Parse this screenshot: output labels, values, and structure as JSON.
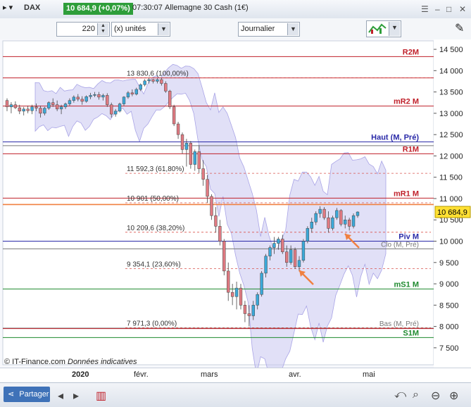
{
  "titlebar": {
    "instrument": "DAX",
    "quote": "10 684,9 (+0,07%)",
    "time": "07:30:07",
    "name": "Allemagne 30 Cash (1€)"
  },
  "toolbar": {
    "units_value": "220",
    "units_label": "(x) unités",
    "timeframe": "Journalier"
  },
  "colors": {
    "quote_bg": "#2e9e3a",
    "resistance": "#c0202a",
    "support": "#1e8a2e",
    "pivot": "#2a2aa8",
    "fibo": "#d9534f",
    "candle_up": "#3ba8d8",
    "candle_down": "#e07a82",
    "band": "#c9c6f0",
    "arrow": "#f08040"
  },
  "price_axis": {
    "min": 7300,
    "max": 14600,
    "ticks": [
      "14 500",
      "14 000",
      "13 500",
      "13 000",
      "12 500",
      "12 000",
      "11 500",
      "11 000",
      "10 500",
      "10 000",
      "9 500",
      "9 000",
      "8 500",
      "8 000",
      "7 500"
    ],
    "current": "10 684,9"
  },
  "time_axis": {
    "labels": [
      "2020",
      "févr.",
      "mars",
      "avr.",
      "mai"
    ]
  },
  "levels": [
    {
      "name": "R2M",
      "value": 14330,
      "type": "r"
    },
    {
      "name": "",
      "value": 13830,
      "type": "r"
    },
    {
      "name": "mR2 M",
      "value": 13170,
      "type": "r"
    },
    {
      "name": "Haut (M, Pré)",
      "value": 12330,
      "type": "p"
    },
    {
      "name": "",
      "value": 12240,
      "type": "g"
    },
    {
      "name": "R1M",
      "value": 12050,
      "type": "r"
    },
    {
      "name": "mR1 M",
      "value": 11010,
      "type": "r"
    },
    {
      "name": "",
      "value": 10860,
      "type": "o"
    },
    {
      "name": "Piv M",
      "value": 10000,
      "type": "p"
    },
    {
      "name": "Clo (M, Pré)",
      "value": 9820,
      "type": "g"
    },
    {
      "name": "mS1 M",
      "value": 8880,
      "type": "s"
    },
    {
      "name": "Bas (M, Pré)",
      "value": 7960,
      "type": "g"
    },
    {
      "name": "",
      "value": 7950,
      "type": "r"
    },
    {
      "name": "S1M",
      "value": 7740,
      "type": "s"
    }
  ],
  "fibo": [
    {
      "label": "13 830,6 (100,00%)",
      "value": 13830.6
    },
    {
      "label": "11 592,3 (61,80%)",
      "value": 11592.3
    },
    {
      "label": "10 901 (50,00%)",
      "value": 10901
    },
    {
      "label": "10 209,6 (38,20%)",
      "value": 10209.6
    },
    {
      "label": "9 354,1 (23,60%)",
      "value": 9354.1
    },
    {
      "label": "7 971,3 (0,00%)",
      "value": 7971.3
    }
  ],
  "footer": {
    "source": "© IT-Finance.com",
    "note": "Données indicatives"
  },
  "bottombar": {
    "share_label": "Partager"
  },
  "chart_data": {
    "type": "candlestick",
    "ohlc": [
      [
        13300,
        13350,
        13050,
        13150
      ],
      [
        13150,
        13260,
        13000,
        13200
      ],
      [
        13200,
        13280,
        13100,
        13130
      ],
      [
        13130,
        13200,
        12980,
        13050
      ],
      [
        13050,
        13150,
        12950,
        13100
      ],
      [
        13100,
        13180,
        13000,
        13060
      ],
      [
        13060,
        13200,
        12980,
        13150
      ],
      [
        13150,
        13230,
        13050,
        13120
      ],
      [
        13120,
        13180,
        12900,
        13000
      ],
      [
        13000,
        13150,
        12950,
        13120
      ],
      [
        13120,
        13280,
        13080,
        13250
      ],
      [
        13250,
        13350,
        13150,
        13200
      ],
      [
        13200,
        13300,
        13050,
        13100
      ],
      [
        13100,
        13200,
        12980,
        13150
      ],
      [
        13150,
        13250,
        13100,
        13220
      ],
      [
        13220,
        13350,
        13180,
        13300
      ],
      [
        13300,
        13420,
        13250,
        13380
      ],
      [
        13380,
        13450,
        13280,
        13330
      ],
      [
        13330,
        13400,
        13200,
        13280
      ],
      [
        13280,
        13420,
        13250,
        13390
      ],
      [
        13390,
        13480,
        13330,
        13420
      ],
      [
        13420,
        13500,
        13380,
        13440
      ],
      [
        13440,
        13500,
        13320,
        13380
      ],
      [
        13380,
        13460,
        13300,
        13420
      ],
      [
        13420,
        13470,
        13150,
        13200
      ],
      [
        13200,
        13250,
        12900,
        12980
      ],
      [
        12980,
        13100,
        12920,
        13050
      ],
      [
        13050,
        13250,
        13020,
        13220
      ],
      [
        13220,
        13400,
        13180,
        13380
      ],
      [
        13380,
        13520,
        13340,
        13480
      ],
      [
        13480,
        13560,
        13400,
        13450
      ],
      [
        13450,
        13600,
        13420,
        13560
      ],
      [
        13560,
        13700,
        13520,
        13670
      ],
      [
        13670,
        13800,
        13630,
        13760
      ],
      [
        13760,
        13830,
        13700,
        13790
      ],
      [
        13790,
        13810,
        13700,
        13750
      ],
      [
        13750,
        13820,
        13700,
        13790
      ],
      [
        13790,
        13830,
        13650,
        13700
      ],
      [
        13700,
        13750,
        13480,
        13520
      ],
      [
        13520,
        13550,
        13100,
        13150
      ],
      [
        13150,
        13200,
        12700,
        12750
      ],
      [
        12750,
        12800,
        12400,
        12500
      ],
      [
        12500,
        12550,
        12050,
        12150
      ],
      [
        12150,
        12400,
        11750,
        12300
      ],
      [
        12300,
        12350,
        11700,
        11800
      ],
      [
        11800,
        12150,
        11650,
        12100
      ],
      [
        12100,
        12250,
        11600,
        11700
      ],
      [
        11700,
        11900,
        11300,
        11450
      ],
      [
        11450,
        11550,
        10900,
        11050
      ],
      [
        11050,
        11100,
        10500,
        10600
      ],
      [
        10600,
        10800,
        10200,
        10350
      ],
      [
        10350,
        10500,
        9900,
        10000
      ],
      [
        10000,
        10050,
        9200,
        9300
      ],
      [
        9300,
        9500,
        8600,
        8800
      ],
      [
        8800,
        9000,
        8500,
        8700
      ],
      [
        8700,
        9050,
        8400,
        8900
      ],
      [
        8900,
        9000,
        8400,
        8500
      ],
      [
        8500,
        8600,
        8100,
        8300
      ],
      [
        8300,
        8500,
        8000,
        8250
      ],
      [
        8250,
        8600,
        8150,
        8500
      ],
      [
        8500,
        8800,
        8400,
        8750
      ],
      [
        8750,
        9300,
        8700,
        9250
      ],
      [
        9250,
        9700,
        9150,
        9650
      ],
      [
        9650,
        9900,
        9550,
        9850
      ],
      [
        9850,
        10100,
        9700,
        9950
      ],
      [
        9950,
        10100,
        9800,
        10050
      ],
      [
        10050,
        10150,
        9700,
        9750
      ],
      [
        9750,
        9900,
        9400,
        9500
      ],
      [
        9500,
        9900,
        9450,
        9800
      ],
      [
        9800,
        9850,
        9350,
        9400
      ],
      [
        9400,
        9650,
        9300,
        9550
      ],
      [
        9550,
        10050,
        9500,
        10000
      ],
      [
        10000,
        10350,
        9950,
        10300
      ],
      [
        10300,
        10550,
        10200,
        10450
      ],
      [
        10450,
        10700,
        10380,
        10650
      ],
      [
        10650,
        10820,
        10550,
        10750
      ],
      [
        10750,
        10800,
        10500,
        10550
      ],
      [
        10550,
        10700,
        10200,
        10300
      ],
      [
        10300,
        10600,
        10250,
        10550
      ],
      [
        10550,
        10780,
        10500,
        10720
      ],
      [
        10720,
        10750,
        10350,
        10400
      ],
      [
        10400,
        10600,
        10300,
        10500
      ],
      [
        10500,
        10550,
        10250,
        10350
      ],
      [
        10350,
        10650,
        10300,
        10600
      ],
      [
        10600,
        10700,
        10550,
        10685
      ]
    ]
  }
}
